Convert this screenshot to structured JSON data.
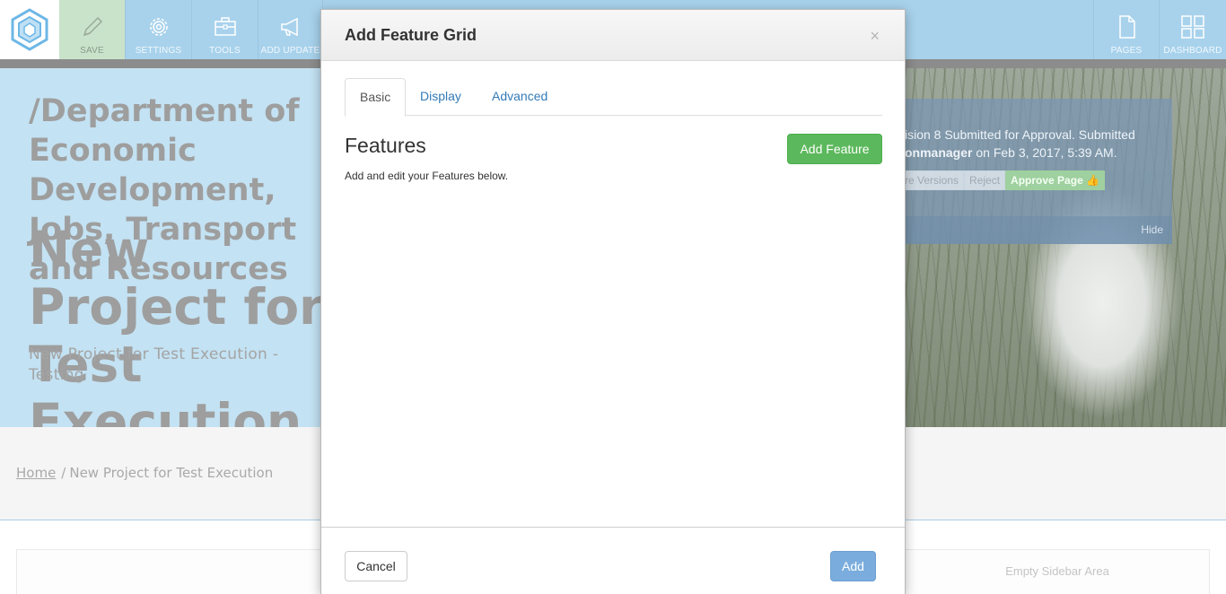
{
  "toolbar": {
    "save_label": "SAVE",
    "settings_label": "SETTINGS",
    "tools_label": "TOOLS",
    "add_update_label": "ADD UPDATE",
    "pages_label": "PAGES",
    "dashboard_label": "DASHBOARD",
    "colors": {
      "bar": "#a8d2ec",
      "save_bg": "#c9e3ca"
    },
    "icons": [
      "logo-icon",
      "pencil-icon",
      "gear-icon",
      "briefcase-icon",
      "megaphone-icon",
      "page-icon",
      "dashboard-grid-icon"
    ]
  },
  "hero": {
    "department_title": "/Department of Economic Development, Jobs, Transport and Resources",
    "page_title": "New Project for Test Execution",
    "subtitle": "New Project for Test Execution - Testing"
  },
  "approval": {
    "message_start": "ision 8 Submitted for Approval. Submitted",
    "submitter": "onmanager",
    "message_end": " on Feb 3, 2017, 5:39 AM.",
    "versions_label": "re Versions",
    "reject_label": "Reject",
    "approve_label": "Approve Page",
    "hide_label": "Hide"
  },
  "breadcrumb": {
    "home": "Home",
    "separator": "/",
    "current": "New Project for Test Execution"
  },
  "sidebar": {
    "empty_label": "Empty Sidebar Area"
  },
  "modal": {
    "title": "Add Feature Grid",
    "close_label": "×",
    "tabs": [
      {
        "label": "Basic",
        "active": true
      },
      {
        "label": "Display",
        "active": false
      },
      {
        "label": "Advanced",
        "active": false
      }
    ],
    "features_heading": "Features",
    "features_description": "Add and edit your Features below.",
    "add_feature_label": "Add Feature",
    "cancel_label": "Cancel",
    "add_label": "Add",
    "colors": {
      "add_feature": "#5cb85c",
      "add": "#7aaddd"
    }
  }
}
